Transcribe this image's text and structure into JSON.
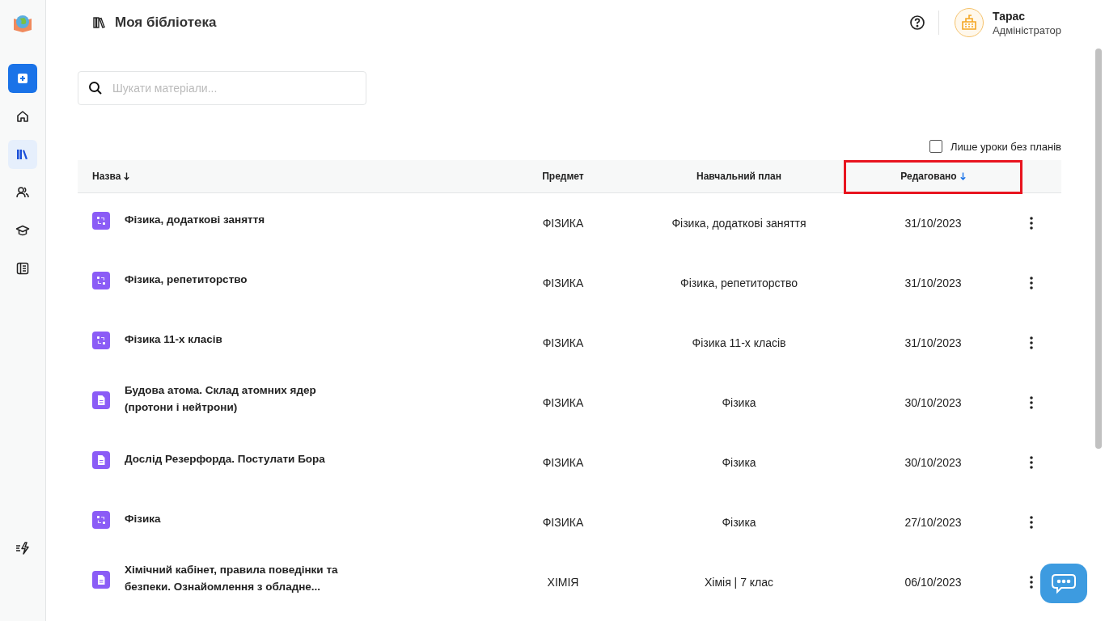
{
  "sidebar": {
    "items": [
      {
        "kind": "home",
        "selected": false
      },
      {
        "kind": "library",
        "selected": true
      },
      {
        "kind": "people",
        "selected": false
      },
      {
        "kind": "education",
        "selected": false
      },
      {
        "kind": "notebook",
        "selected": false
      }
    ]
  },
  "header": {
    "title": "Моя бібліотека",
    "user": {
      "name": "Тарас",
      "role": "Адміністратор"
    }
  },
  "search": {
    "placeholder": "Шукати матеріали..."
  },
  "filter": {
    "label": "Лише уроки без планів",
    "checked": false
  },
  "table": {
    "columns": [
      {
        "label": "Назва",
        "sort_active": false
      },
      {
        "label": "Предмет"
      },
      {
        "label": "Навчальний план"
      },
      {
        "label": "Редаговано",
        "sort_active": true,
        "highlighted": true
      }
    ],
    "rows": [
      {
        "kind": "course",
        "title": "Фізика, додаткові заняття",
        "subject": "ФІЗИКА",
        "plan": "Фізика, додаткові заняття",
        "edited": "31/10/2023"
      },
      {
        "kind": "course",
        "title": "Фізика, репетиторство",
        "subject": "ФІЗИКА",
        "plan": "Фізика, репетиторство",
        "edited": "31/10/2023"
      },
      {
        "kind": "course",
        "title": "Фізика 11-х класів",
        "subject": "ФІЗИКА",
        "plan": "Фізика 11-х класів",
        "edited": "31/10/2023"
      },
      {
        "kind": "lesson",
        "title": "Будова атома. Склад атомних ядер (протони і нейтрони)",
        "subject": "ФІЗИКА",
        "plan": "Фізика",
        "edited": "30/10/2023"
      },
      {
        "kind": "lesson",
        "title": "Дослід Резерфорда. Постулати Бора",
        "subject": "ФІЗИКА",
        "plan": "Фізика",
        "edited": "30/10/2023"
      },
      {
        "kind": "course",
        "title": "Фізика",
        "subject": "ФІЗИКА",
        "plan": "Фізика",
        "edited": "27/10/2023"
      },
      {
        "kind": "lesson",
        "title": "Хімічний кабінет, правила поведінки та безпеки. Ознайомлення з обладне...",
        "subject": "ХІМІЯ",
        "plan": "Хімія | 7 клас",
        "edited": "06/10/2023"
      }
    ]
  }
}
